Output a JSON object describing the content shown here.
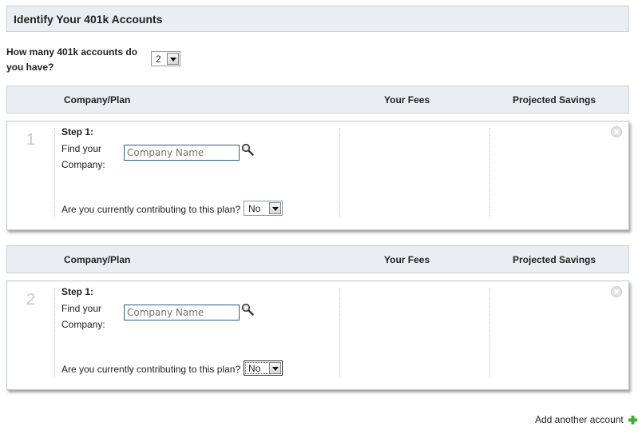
{
  "page": {
    "title": "Identify Your 401k Accounts"
  },
  "account_count": {
    "question": "How many 401k accounts do you have?",
    "selected": "2"
  },
  "table_headers": {
    "company_plan": "Company/Plan",
    "your_fees": "Your Fees",
    "projected_savings": "Projected Savings"
  },
  "accounts": [
    {
      "number": "1",
      "step_label": "Step 1:",
      "find_label": "Find your Company:",
      "company_placeholder": "Company Name",
      "contributing_question": "Are you currently contributing to this plan?",
      "contributing_value": "No"
    },
    {
      "number": "2",
      "step_label": "Step 1:",
      "find_label": "Find your Company:",
      "company_placeholder": "Company Name",
      "contributing_question": "Are you currently contributing to this plan?",
      "contributing_value": "No"
    }
  ],
  "footer": {
    "add_account_label": "Add another account"
  },
  "icons": {
    "search": "search-icon",
    "close": "close-icon",
    "add": "plus-icon"
  },
  "colors": {
    "header_bg": "#e9eef2",
    "input_border": "#2e5f84",
    "plus_green": "#3fae3a"
  }
}
